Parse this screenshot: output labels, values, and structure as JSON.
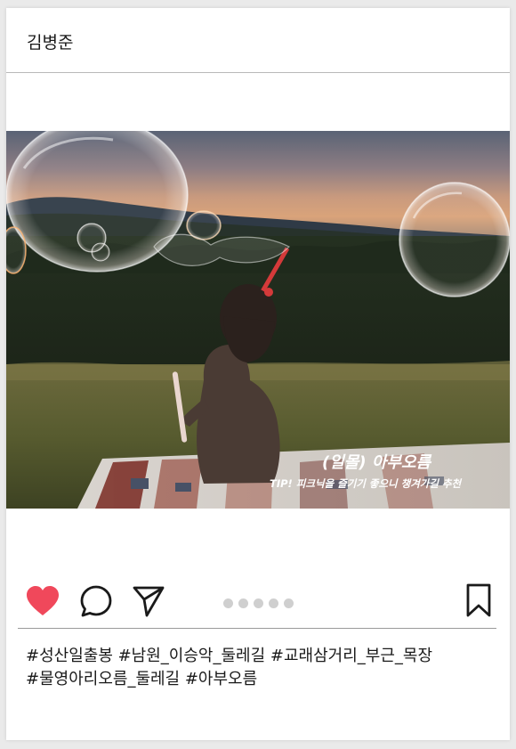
{
  "post": {
    "username": "김병준",
    "photo": {
      "overlay_title": "(일몰) 아부오름",
      "overlay_tip": "TIP! 피크닉을 즐기기 좋으니 챙겨가길 추천"
    },
    "carousel": {
      "total": 5
    },
    "actions": {
      "like_icon": "heart-icon",
      "comment_icon": "comment-icon",
      "share_icon": "send-icon",
      "save_icon": "bookmark-icon",
      "like_color": "#f0485b"
    },
    "hashtags": {
      "line1": "#성산일출봉 #남원_이승악_둘레길 #교래삼거리_부근_목장",
      "line2": "#물영아리오름_둘레길 #아부오름"
    }
  }
}
